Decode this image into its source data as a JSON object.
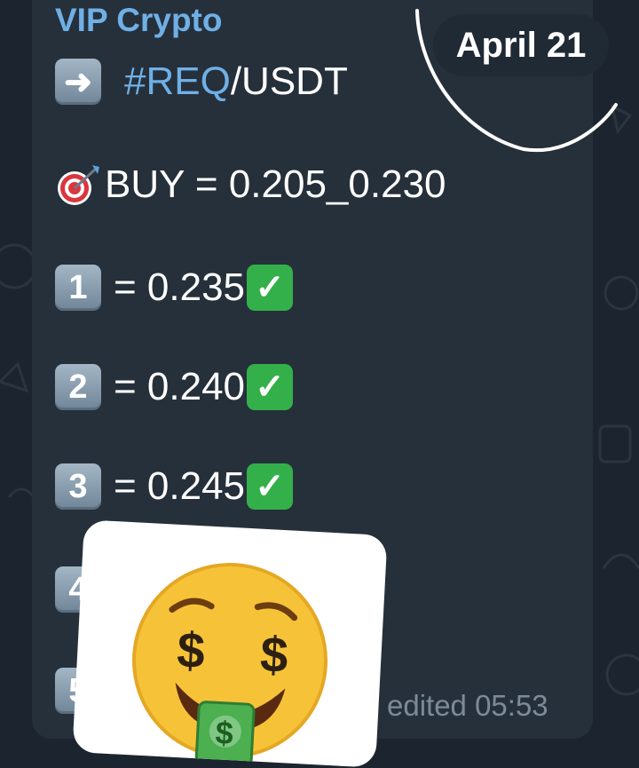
{
  "chat": {
    "sender": "VIP Crypto",
    "date_badge": "April 21",
    "pair_prefix": "#REQ",
    "pair_suffix": "/USDT",
    "buy_line": "BUY = 0.205_0.230",
    "targets": [
      {
        "num": "1",
        "text": "= 0.235",
        "check": "✓"
      },
      {
        "num": "2",
        "text": "= 0.240",
        "check": "✓"
      },
      {
        "num": "3",
        "text": "= 0.245",
        "check": "✓"
      },
      {
        "num": "4",
        "text": ""
      },
      {
        "num": "5",
        "text": ""
      }
    ],
    "arrow_glyph": "➜",
    "timestamp": "edited 05:53"
  },
  "icons": {
    "arrow": "right-arrow-icon",
    "target": "direct-hit-icon",
    "check": "check-mark-icon",
    "sticker": "money-mouth-face-icon"
  },
  "colors": {
    "background": "#1c252f",
    "bubble": "#26303b",
    "link": "#6fb0e6",
    "check": "#34b04a",
    "keycap": "#8aa0b2"
  }
}
